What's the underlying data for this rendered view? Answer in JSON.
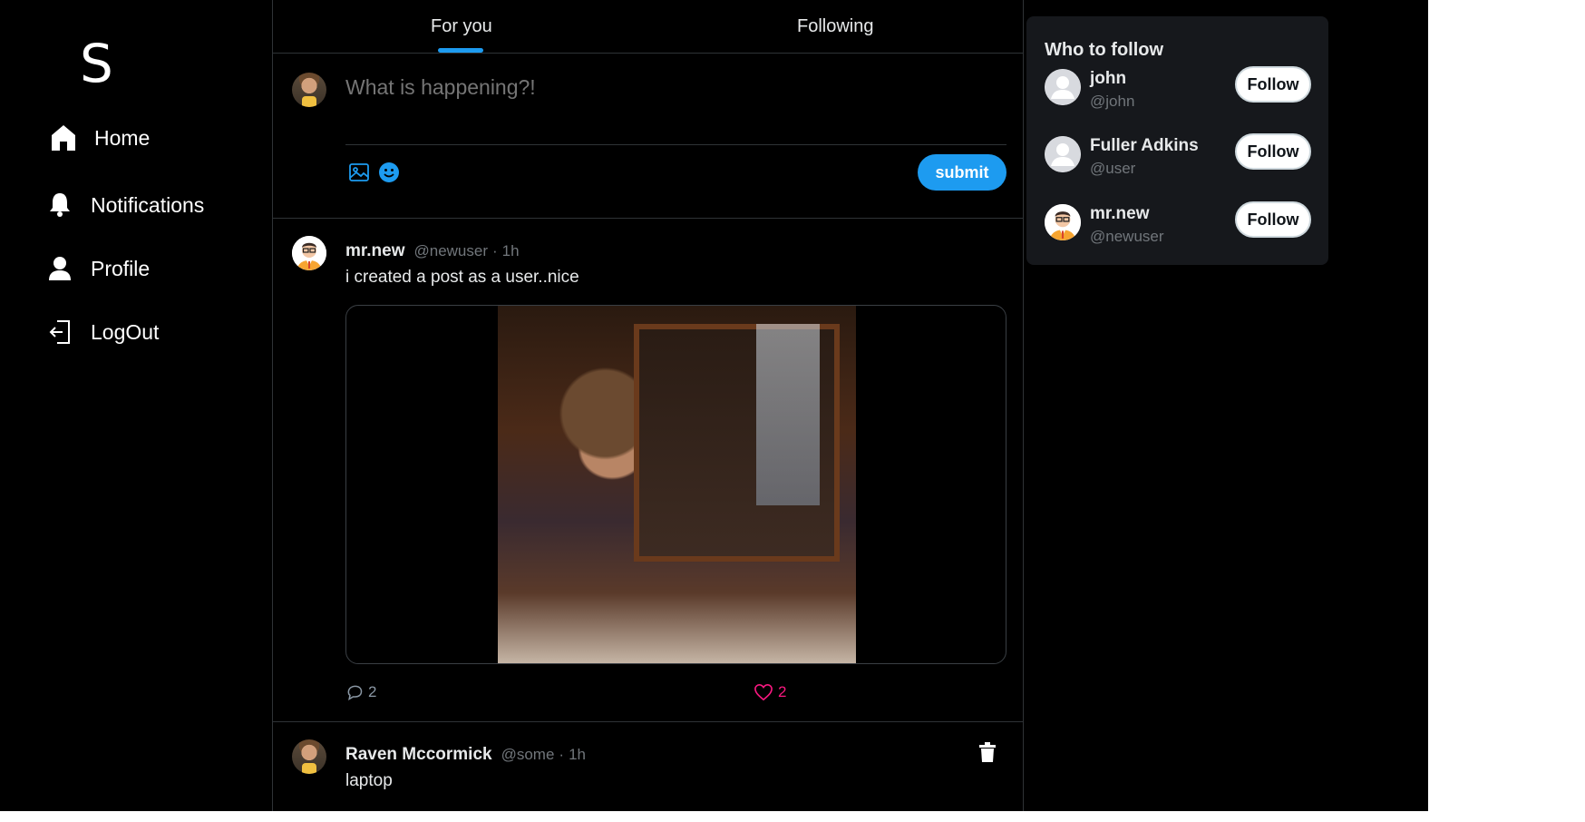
{
  "brand": {
    "logo": "S"
  },
  "nav": {
    "items": [
      {
        "label": "Home",
        "icon": "home-icon"
      },
      {
        "label": "Notifications",
        "icon": "bell-icon"
      },
      {
        "label": "Profile",
        "icon": "user-icon"
      },
      {
        "label": "LogOut",
        "icon": "logout-icon"
      }
    ]
  },
  "tabs": [
    {
      "label": "For you",
      "active": true
    },
    {
      "label": "Following",
      "active": false
    }
  ],
  "composer": {
    "placeholder": "What is happening?!",
    "submit_label": "submit",
    "accent_color": "#1d9bf0"
  },
  "posts": [
    {
      "name": "mr.new",
      "handle": "@newuser",
      "separator": "·",
      "time": "1h",
      "text": "i created a post as a user..nice",
      "has_image": true,
      "replies": "2",
      "likes": "2"
    },
    {
      "name": "Raven Mccormick",
      "handle": "@some",
      "separator": "·",
      "time": "1h",
      "text": "laptop",
      "has_image": false
    }
  ],
  "who_to_follow": {
    "title": "Who to follow",
    "users": [
      {
        "name": "john",
        "handle": "@john",
        "button": "Follow"
      },
      {
        "name": "Fuller Adkins",
        "handle": "@user",
        "button": "Follow"
      },
      {
        "name": "mr.new",
        "handle": "@newuser",
        "button": "Follow"
      }
    ]
  }
}
